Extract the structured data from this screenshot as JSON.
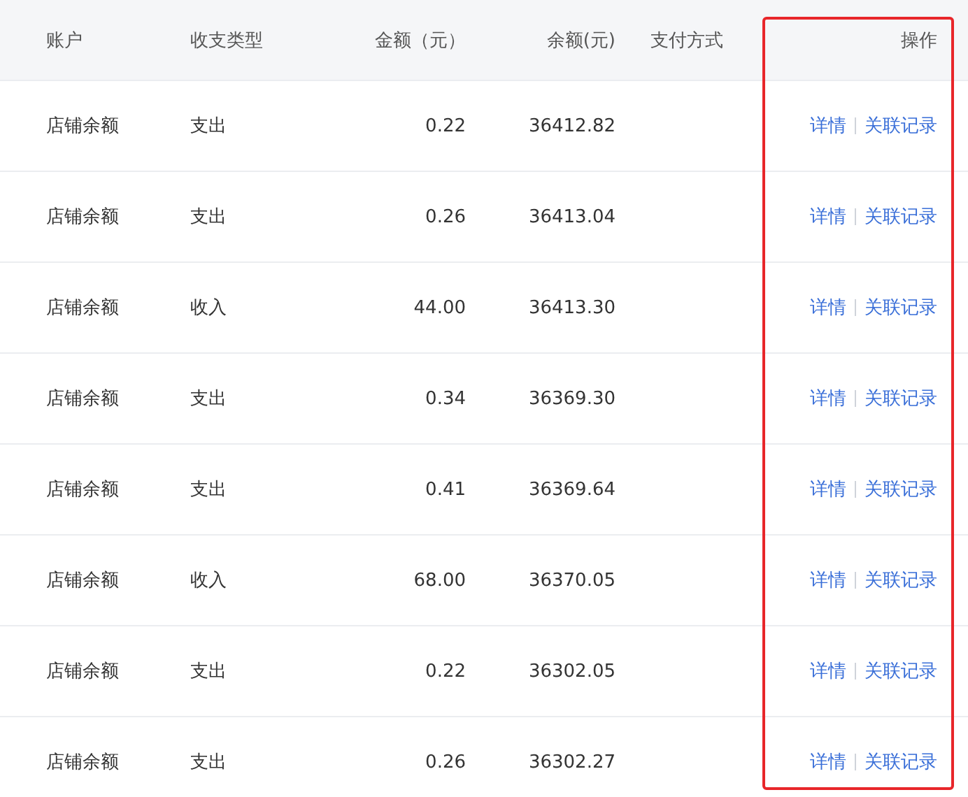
{
  "table": {
    "columns": [
      "账户",
      "收支类型",
      "金额（元）",
      "余额(元)",
      "支付方式",
      "操作"
    ],
    "rows": [
      {
        "account": "店铺余额",
        "type": "支出",
        "amount": "0.22",
        "balance": "36412.82",
        "actions": [
          "详情",
          "关联记录"
        ]
      },
      {
        "account": "店铺余额",
        "type": "支出",
        "amount": "0.26",
        "balance": "36413.04",
        "actions": [
          "详情",
          "关联记录"
        ]
      },
      {
        "account": "店铺余额",
        "type": "收入",
        "amount": "44.00",
        "balance": "36413.30",
        "actions": [
          "详情",
          "关联记录"
        ]
      },
      {
        "account": "店铺余额",
        "type": "支出",
        "amount": "0.34",
        "balance": "36369.30",
        "actions": [
          "详情",
          "关联记录"
        ]
      },
      {
        "account": "店铺余额",
        "type": "支出",
        "amount": "0.41",
        "balance": "36369.64",
        "actions": [
          "详情",
          "关联记录"
        ]
      },
      {
        "account": "店铺余额",
        "type": "收入",
        "amount": "68.00",
        "balance": "36370.05",
        "actions": [
          "详情",
          "关联记录"
        ]
      },
      {
        "account": "店铺余额",
        "type": "支出",
        "amount": "0.22",
        "balance": "36302.05",
        "actions": [
          "详情",
          "关联记录"
        ]
      },
      {
        "account": "店铺余额",
        "type": "支出",
        "amount": "0.26",
        "balance": "36302.27",
        "actions": [
          "详情",
          "关联记录"
        ]
      }
    ]
  }
}
